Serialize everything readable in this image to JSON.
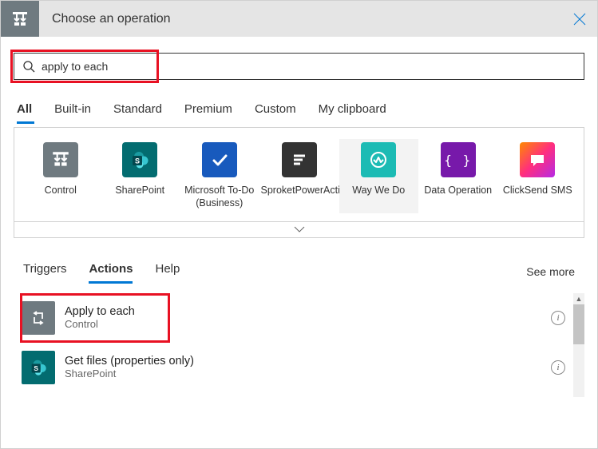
{
  "header": {
    "title": "Choose an operation"
  },
  "search": {
    "value": "apply to each"
  },
  "categoryTabs": [
    "All",
    "Built-in",
    "Standard",
    "Premium",
    "Custom",
    "My clipboard"
  ],
  "activeCategory": 0,
  "connectors": [
    {
      "label": "Control",
      "icon": "control"
    },
    {
      "label": "SharePoint",
      "icon": "sharepoint"
    },
    {
      "label": "Microsoft To-Do (Business)",
      "icon": "mstodo"
    },
    {
      "label": "SproketPowerActions",
      "icon": "sproket"
    },
    {
      "label": "Way We Do",
      "icon": "waywedo"
    },
    {
      "label": "Data Operation",
      "icon": "dataop"
    },
    {
      "label": "ClickSend SMS",
      "icon": "clicksend"
    }
  ],
  "actionTabs": [
    "Triggers",
    "Actions",
    "Help"
  ],
  "activeActionTab": 1,
  "seeMore": "See more",
  "actions": [
    {
      "title": "Apply to each",
      "subtitle": "Control",
      "icon": "control-loop"
    },
    {
      "title": "Get files (properties only)",
      "subtitle": "SharePoint",
      "icon": "sharepoint"
    }
  ]
}
